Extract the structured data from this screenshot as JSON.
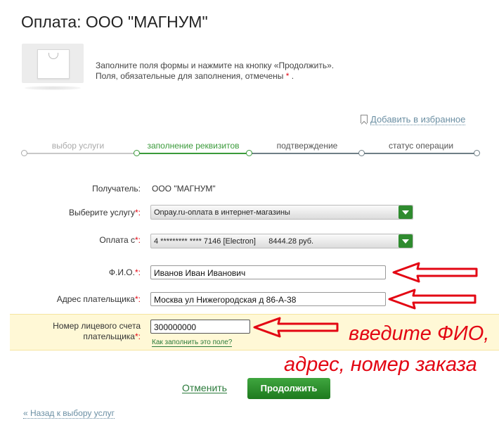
{
  "page": {
    "title": "Оплата: ООО \"МАГНУМ\""
  },
  "hint": {
    "line1": "Заполните поля формы и нажмите на кнопку «Продолжить».",
    "line2": "Поля, обязательные для заполнения, отмечены ",
    "required_mark": "*",
    "line2_end": " ."
  },
  "favorites": {
    "label": "Добавить в избранное"
  },
  "steps": [
    {
      "label": "выбор услуги",
      "state": "done"
    },
    {
      "label": "заполнение реквизитов",
      "state": "active"
    },
    {
      "label": "подтверждение",
      "state": "pending"
    },
    {
      "label": "статус операции",
      "state": "pending"
    }
  ],
  "form": {
    "recipient": {
      "label": "Получатель:",
      "value": "ООО \"МАГНУМ\""
    },
    "service": {
      "label": "Выберите услугу",
      "req": "*:",
      "value": "Onpay.ru-оплата в интернет-магазины"
    },
    "payfrom": {
      "label": "Оплата с",
      "req": "*:",
      "value": "4 ********* **** 7146 [Electron]      8444.28 руб."
    },
    "fio": {
      "label": "Ф.И.О.",
      "req": "*:",
      "value": "Иванов Иван Иванович"
    },
    "address": {
      "label": "Адрес плательщика",
      "req": "*:",
      "value": "Москва ул Нижегородская д 86-А-38"
    },
    "account": {
      "label_line1": "Номер лицевого счета",
      "label_line2": "плательщика",
      "req": "*:",
      "value": "300000000",
      "help": "Как заполнить это поле?"
    }
  },
  "annotation": {
    "line1": "введите ФИО,",
    "line2": "адрес, номер заказа"
  },
  "actions": {
    "cancel": "Отменить",
    "continue": "Продолжить",
    "back": "« Назад к выбору услуг"
  },
  "colors": {
    "accent_green": "#2f8b2f",
    "step_active": "#3a9a3a",
    "annotation_red": "#e30613",
    "link_blue": "#6b8fa3",
    "highlight_bg": "#fff8d6"
  }
}
